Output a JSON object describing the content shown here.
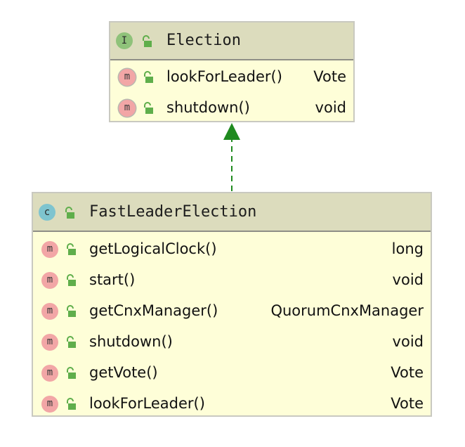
{
  "diagram": {
    "interface_box": {
      "kind_letter": "I",
      "title": "Election",
      "methods": [
        {
          "name": "lookForLeader()",
          "type": "Vote",
          "badge": "m"
        },
        {
          "name": "shutdown()",
          "type": "void",
          "badge": "m"
        }
      ]
    },
    "class_box": {
      "kind_letter": "c",
      "title": "FastLeaderElection",
      "methods": [
        {
          "name": "getLogicalClock()",
          "type": "long",
          "badge": "m"
        },
        {
          "name": "start()",
          "type": "void",
          "badge": "m"
        },
        {
          "name": "getCnxManager()",
          "type": "QuorumCnxManager",
          "badge": "m"
        },
        {
          "name": "shutdown()",
          "type": "void",
          "badge": "m"
        },
        {
          "name": "getVote()",
          "type": "Vote",
          "badge": "m"
        },
        {
          "name": "lookForLeader()",
          "type": "Vote",
          "badge": "m"
        }
      ]
    },
    "relation": {
      "kind": "realization",
      "color": "#1f8a1f"
    },
    "colors": {
      "box_fill": "#fefed8",
      "header_fill": "#dcdcbd",
      "method_badge": "#f2a6a6",
      "interface_badge": "#8fc27a",
      "class_badge": "#7ec4cf",
      "lock_green": "#5fae4b"
    }
  }
}
